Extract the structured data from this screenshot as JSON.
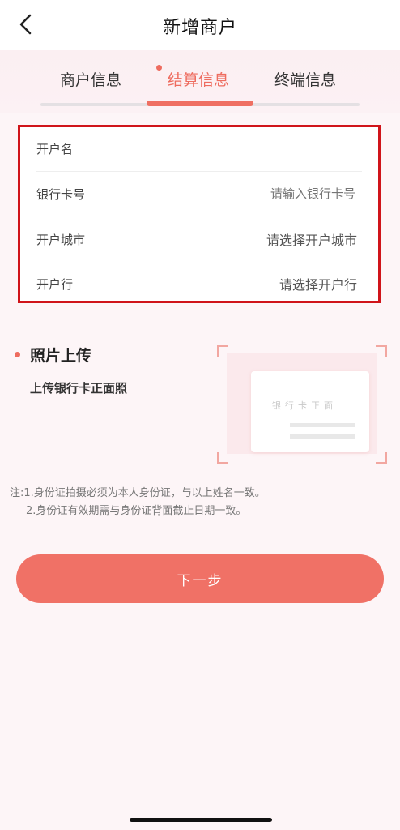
{
  "header": {
    "title": "新增商户",
    "back_icon": "chevron-left-icon"
  },
  "tabs": [
    {
      "label": "商户信息",
      "active": false
    },
    {
      "label": "结算信息",
      "active": true
    },
    {
      "label": "终端信息",
      "active": false
    }
  ],
  "step_progress": {
    "current_step": 2,
    "total_steps": 3
  },
  "form": {
    "account_name": {
      "label": "开户名",
      "value": ""
    },
    "bank_card": {
      "label": "银行卡号",
      "placeholder": "请输入银行卡号"
    },
    "city": {
      "label": "开户城市",
      "value": "请选择开户城市"
    },
    "bank": {
      "label": "开户行",
      "value": "请选择开户行"
    }
  },
  "upload": {
    "title": "照片上传",
    "subtitle": "上传银行卡正面照",
    "card_text": "银行卡正面"
  },
  "notes": {
    "line1": "注:1.身份证拍摄必须为本人身份证，与以上姓名一致。",
    "line2": "2.身份证有效期需与身份证背面截止日期一致。"
  },
  "next_button": {
    "label": "下一步"
  },
  "colors": {
    "accent": "#ee6c5f",
    "button": "#f07166",
    "highlight_border": "#d0141a",
    "background": "#fdf5f7"
  }
}
